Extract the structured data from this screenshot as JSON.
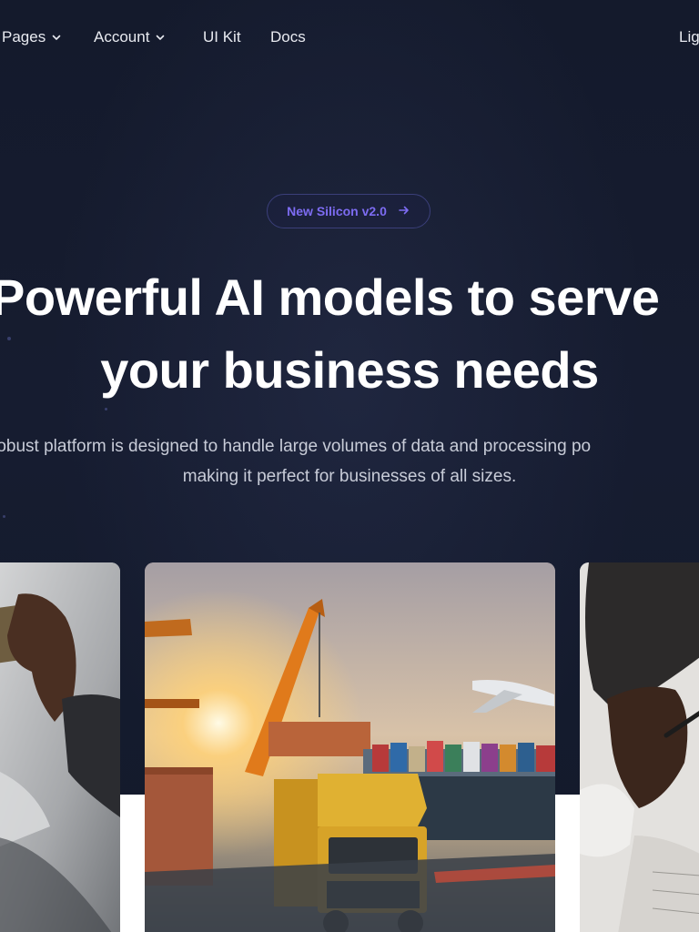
{
  "nav": {
    "items": [
      {
        "label": "Pages",
        "dropdown": true
      },
      {
        "label": "Account",
        "dropdown": true
      },
      {
        "label": "UI Kit",
        "dropdown": false
      },
      {
        "label": "Docs",
        "dropdown": false
      }
    ],
    "right_label": "Lig"
  },
  "badge": {
    "label": "New Silicon v2.0",
    "icon": "arrow-right-icon",
    "color": "#7d6cf2"
  },
  "hero": {
    "headline_line1": "Powerful AI models to serve",
    "headline_line2": "your business needs",
    "subtitle_line1": "robust platform is designed to handle large volumes of data and processing po",
    "subtitle_line2": "making it perfect for businesses of all sizes."
  },
  "colors": {
    "background": "#131a2b",
    "headline": "#ffffff",
    "subtitle": "#c8ccd8",
    "accent": "#7d6cf2"
  },
  "cards": [
    {
      "name": "payment-card-image",
      "icon": "hand-holding-card"
    },
    {
      "name": "logistics-image",
      "icon": "truck-crane-plane"
    },
    {
      "name": "business-writing-image",
      "icon": "hand-with-pen"
    }
  ]
}
